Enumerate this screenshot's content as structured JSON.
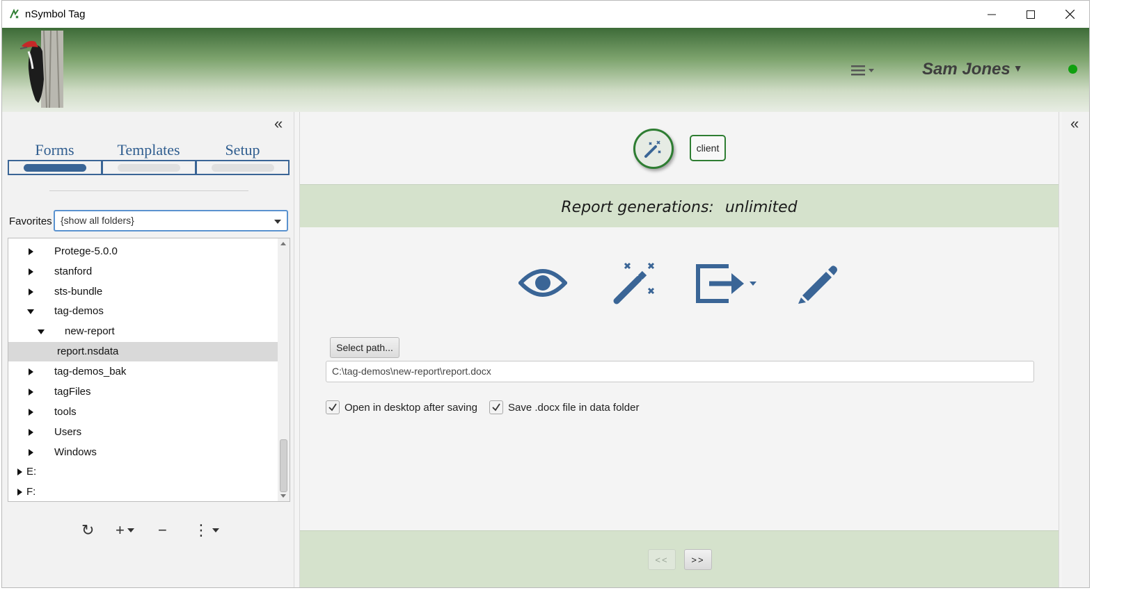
{
  "window": {
    "title": "nSymbol Tag"
  },
  "header": {
    "user_name": "Sam Jones",
    "user_caret": "▼",
    "status_color": "#10a010"
  },
  "left_panel": {
    "collapse_glyph": "«",
    "tabs": [
      {
        "label": "Forms",
        "active": true
      },
      {
        "label": "Templates",
        "active": false
      },
      {
        "label": "Setup",
        "active": false
      }
    ],
    "favorites_label": "Favorites",
    "favorites_value": "{show all folders}",
    "tree": [
      {
        "label": "Protege-5.0.0",
        "expanded": false
      },
      {
        "label": "stanford",
        "expanded": false
      },
      {
        "label": "sts-bundle",
        "expanded": false
      },
      {
        "label": "tag-demos",
        "expanded": true
      },
      {
        "label": "new-report",
        "expanded": true
      },
      {
        "label": "report.nsdata",
        "selected": true
      },
      {
        "label": "tag-demos_bak",
        "expanded": false
      },
      {
        "label": "tagFiles",
        "expanded": false
      },
      {
        "label": "tools",
        "expanded": false
      },
      {
        "label": "Users",
        "expanded": false
      },
      {
        "label": "Windows",
        "expanded": false
      },
      {
        "label": "E:",
        "expanded": false
      },
      {
        "label": "F:",
        "expanded": false
      }
    ],
    "toolbar": {
      "refresh_glyph": "↻",
      "add_glyph": "+",
      "remove_glyph": "−",
      "more_glyph": "⋮"
    }
  },
  "center": {
    "client_badge": "client",
    "report_generations_label": "Report generations:",
    "report_generations_value": "unlimited",
    "actions": [
      "view-eye",
      "generate-wand",
      "export",
      "edit-pencil"
    ],
    "select_path_label": "Select path...",
    "output_path": "C:\\tag-demos\\new-report\\report.docx",
    "checkboxes": [
      {
        "label": "Open in desktop after saving",
        "checked": true
      },
      {
        "label": "Save .docx file in data folder",
        "checked": true
      }
    ],
    "nav": {
      "prev_label": "<<",
      "next_label": ">>"
    },
    "accent_color": "#2f5d8f"
  },
  "right_panel": {
    "collapse_glyph": "«"
  }
}
